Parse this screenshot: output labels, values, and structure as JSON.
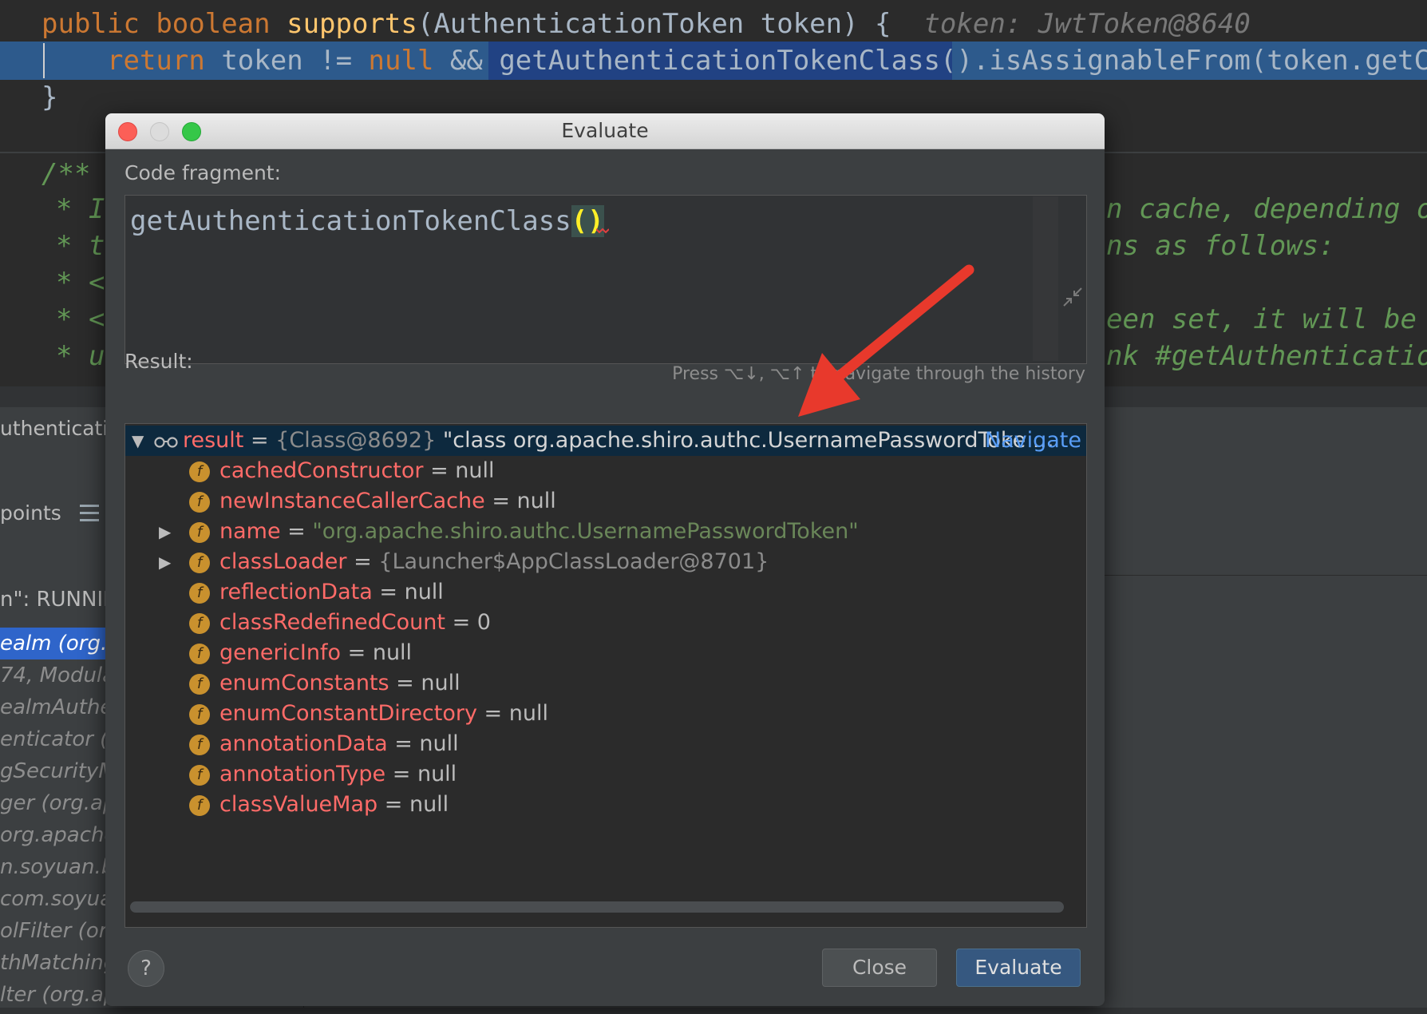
{
  "editor": {
    "line1": {
      "kw_public": "public",
      "kw_boolean": "boolean",
      "method": "supports",
      "params": "(AuthenticationToken token) {",
      "inline_hint": "token: JwtToken@8640"
    },
    "line2": {
      "kw_return": "return",
      "t1": "token != ",
      "kw_null": "null",
      "t2": " && ",
      "call1": "getAuthenticationTokenClass()",
      "call2": ".isAssignableFrom(token.getCla"
    },
    "line3": "}",
    "doc_open": "/**",
    "doc_lines_left": [
      "* I",
      "* t",
      "* <",
      "* <",
      "* u"
    ],
    "doc_lines_right": [
      "n cache, depending on",
      "ns as follows:",
      "",
      "een set, it will be",
      "nk #getAuthentication"
    ]
  },
  "debug": {
    "tab_label": "uthenticating",
    "breakpoints_label": "points",
    "thread_status": "n\": RUNNIN",
    "frames": [
      "ealm (org.a",
      "74, Modula",
      "ealmAuther",
      "enticator (",
      "gSecurityM",
      "ger (org.ap",
      "org.apache.",
      "n.soyuan.bi",
      "com.soyuan",
      "olFilter (org",
      "thMatching",
      "lter (org.ap"
    ]
  },
  "dialog": {
    "title": "Evaluate",
    "code_fragment_label": "Code fragment:",
    "code_method": "getAuthenticationTokenClass",
    "code_parens": "()",
    "history_hint": "Press ⌥↓, ⌥↑ to navigate through the history",
    "result_label": "Result:",
    "result": {
      "name": "result",
      "eq": " = ",
      "type": "{Class@8692}",
      "value": " \"class org.apache.shiro.authc.UsernamePasswordToke …",
      "navigate": "Navigate"
    },
    "fields": [
      {
        "name": "cachedConstructor",
        "value": "null",
        "kind": "plain",
        "expandable": false
      },
      {
        "name": "newInstanceCallerCache",
        "value": "null",
        "kind": "plain",
        "expandable": false
      },
      {
        "name": "name",
        "value": "\"org.apache.shiro.authc.UsernamePasswordToken\"",
        "kind": "string",
        "expandable": true
      },
      {
        "name": "classLoader",
        "value": "{Launcher$AppClassLoader@8701}",
        "kind": "object",
        "expandable": true
      },
      {
        "name": "reflectionData",
        "value": "null",
        "kind": "plain",
        "expandable": false
      },
      {
        "name": "classRedefinedCount",
        "value": "0",
        "kind": "plain",
        "expandable": false
      },
      {
        "name": "genericInfo",
        "value": "null",
        "kind": "plain",
        "expandable": false
      },
      {
        "name": "enumConstants",
        "value": "null",
        "kind": "plain",
        "expandable": false
      },
      {
        "name": "enumConstantDirectory",
        "value": "null",
        "kind": "plain",
        "expandable": false
      },
      {
        "name": "annotationData",
        "value": "null",
        "kind": "plain",
        "expandable": false
      },
      {
        "name": "annotationType",
        "value": "null",
        "kind": "plain",
        "expandable": false
      },
      {
        "name": "classValueMap",
        "value": "null",
        "kind": "plain",
        "expandable": false
      }
    ],
    "field_icon_letter": "f",
    "help_label": "?",
    "close_label": "Close",
    "evaluate_label": "Evaluate"
  },
  "colors": {
    "accent": "#365880",
    "selection": "#214283",
    "field_name": "#ff6b68",
    "string_value": "#6a8759",
    "arrow": "#e8392c"
  }
}
